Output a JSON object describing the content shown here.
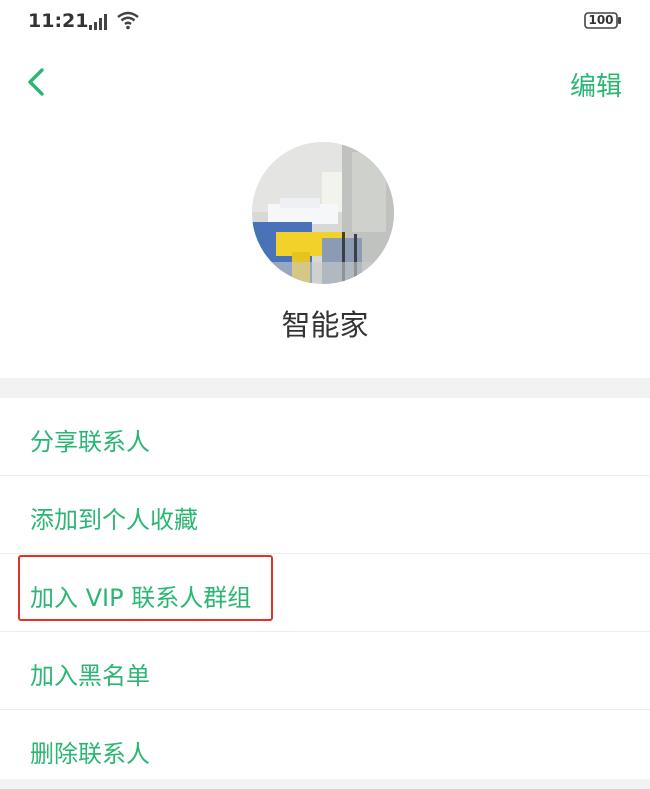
{
  "status_bar": {
    "time": "11:21",
    "battery": "100",
    "icons": [
      "signal-icon",
      "wifi-icon",
      "battery-icon"
    ]
  },
  "nav": {
    "back_icon": "chevron-left-icon",
    "edit_label": "编辑"
  },
  "contact": {
    "name": "智能家",
    "avatar": "photo-avatar"
  },
  "menu": {
    "items": [
      {
        "label": "分享联系人"
      },
      {
        "label": "添加到个人收藏"
      },
      {
        "label": "加入 VIP 联系人群组",
        "highlighted": true
      },
      {
        "label": "加入黑名单"
      },
      {
        "label": "删除联系人"
      }
    ]
  },
  "colors": {
    "accent": "#2bb673",
    "highlight": "#e0342b",
    "divider": "#f2f2f2"
  }
}
